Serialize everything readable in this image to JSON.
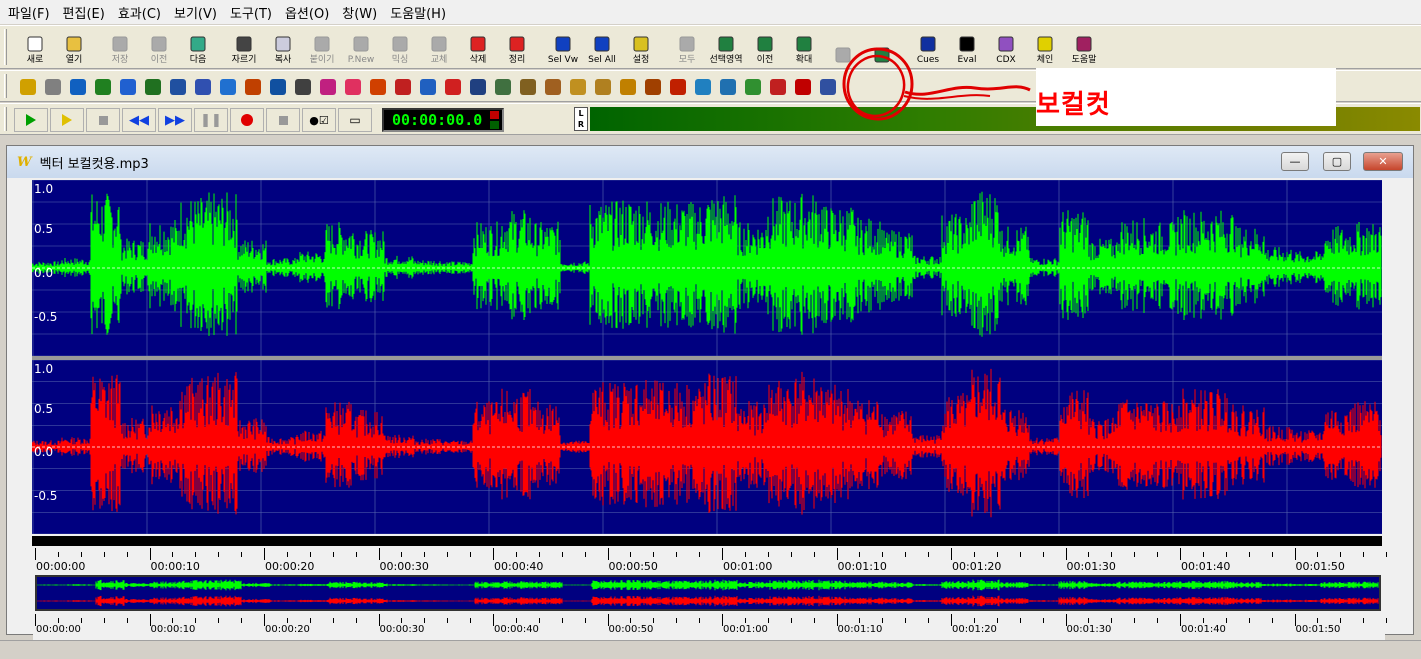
{
  "menu": [
    "파일(F)",
    "편집(E)",
    "효과(C)",
    "보기(V)",
    "도구(T)",
    "옵션(O)",
    "창(W)",
    "도움말(H)"
  ],
  "toolbar1": [
    {
      "label": "새로",
      "icon": "new-file-icon",
      "enabled": true
    },
    {
      "label": "열기",
      "icon": "open-folder-icon",
      "enabled": true
    },
    {
      "label": "저장",
      "icon": "save-disk-icon",
      "enabled": false
    },
    {
      "label": "이전",
      "icon": "undo-icon",
      "enabled": false
    },
    {
      "label": "다음",
      "icon": "redo-icon",
      "enabled": true
    },
    {
      "label": "자르기",
      "icon": "scissors-icon",
      "enabled": true
    },
    {
      "label": "복사",
      "icon": "copy-icon",
      "enabled": true
    },
    {
      "label": "붙이기",
      "icon": "paste-icon",
      "enabled": false
    },
    {
      "label": "P.New",
      "icon": "paste-new-icon",
      "enabled": false
    },
    {
      "label": "믹싱",
      "icon": "mix-paste-icon",
      "enabled": false
    },
    {
      "label": "교체",
      "icon": "replace-icon",
      "enabled": false
    },
    {
      "label": "삭제",
      "icon": "delete-icon",
      "enabled": true
    },
    {
      "label": "정리",
      "icon": "trim-icon",
      "enabled": true
    },
    {
      "label": "Sel Vw",
      "icon": "select-view-icon",
      "enabled": true
    },
    {
      "label": "Sel All",
      "icon": "select-all-icon",
      "enabled": true
    },
    {
      "label": "설정",
      "icon": "settings-question-icon",
      "enabled": true
    },
    {
      "label": "모두",
      "icon": "zoom-all-icon",
      "enabled": false
    },
    {
      "label": "선택영역",
      "icon": "zoom-selection-icon",
      "enabled": true
    },
    {
      "label": "이전",
      "icon": "zoom-previous-icon",
      "enabled": true
    },
    {
      "label": "확대",
      "icon": "zoom-in-icon",
      "enabled": true
    },
    {
      "label": "",
      "icon": "zoom-out-icon",
      "enabled": false
    },
    {
      "label": "",
      "icon": "zoom-1-icon",
      "enabled": true
    },
    {
      "label": "Cues",
      "icon": "cues-icon",
      "enabled": true
    },
    {
      "label": "Eval",
      "icon": "eval-fx-icon",
      "enabled": true
    },
    {
      "label": "CDX",
      "icon": "cdx-disc-icon",
      "enabled": true
    },
    {
      "label": "체인",
      "icon": "chain-help-icon",
      "enabled": true
    },
    {
      "label": "도움말",
      "icon": "help-book-icon",
      "enabled": true
    }
  ],
  "toolbar2_colors": [
    "#d0a000",
    "#808080",
    "#1060c0",
    "#208020",
    "#2060d0",
    "#207020",
    "#2050a0",
    "#3050b0",
    "#2070d0",
    "#c04000",
    "#1050a0",
    "#404040",
    "#c02080",
    "#e03060",
    "#d04000",
    "#c02020",
    "#2060c0",
    "#d02020",
    "#204080",
    "#407040",
    "#806020",
    "#a06020",
    "#c09020",
    "#b08020",
    "#c08000",
    "#a04000",
    "#c02000",
    "#2080c0",
    "#2070b0",
    "#309030",
    "#c02020",
    "#c00000",
    "#3050a0"
  ],
  "transport": {
    "time": "00:00:00.0",
    "lr": "L R"
  },
  "annotation": {
    "text": "보컬컷",
    "color": "#ff0000"
  },
  "window": {
    "title": "벡터 보컬컷용.mp3",
    "logo": "W",
    "min": "—",
    "max": "▢",
    "close": "✕"
  },
  "channels": [
    {
      "name": "left",
      "color": "#00ff00",
      "ylabels": [
        "1.0",
        "0.5",
        "0.0",
        "-0.5"
      ]
    },
    {
      "name": "right",
      "color": "#ff0000",
      "ylabels": [
        "1.0",
        "0.5",
        "0.0",
        "-0.5"
      ]
    }
  ],
  "timeline": [
    "00:00:00",
    "00:00:10",
    "00:00:20",
    "00:00:30",
    "00:00:40",
    "00:00:50",
    "00:01:00",
    "00:01:10",
    "00:01:20",
    "00:01:30",
    "00:01:40",
    "00:01:50"
  ]
}
